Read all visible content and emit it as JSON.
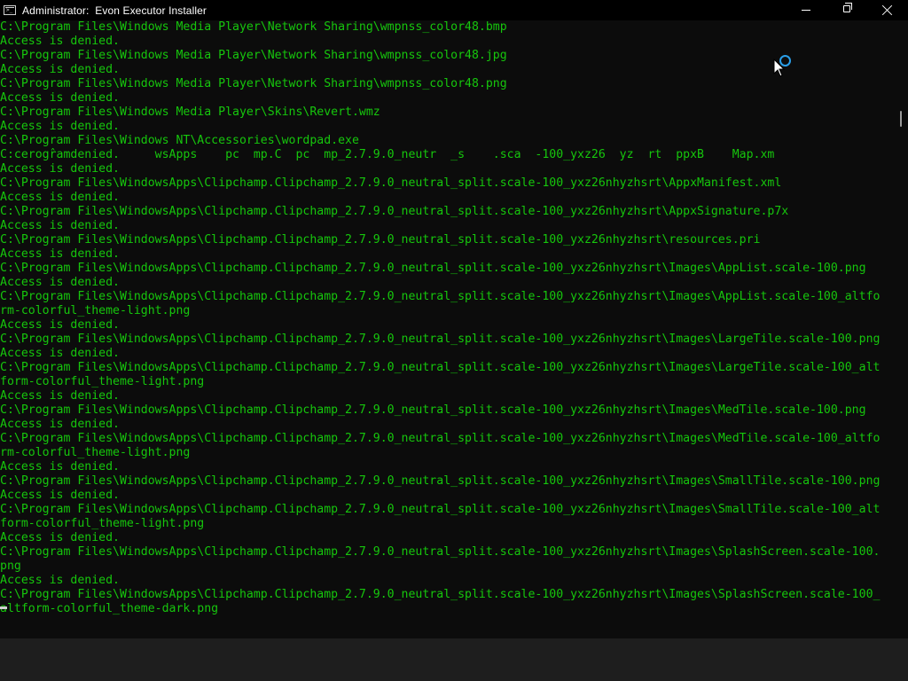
{
  "window": {
    "title": "Administrator:  Evon Executor Installer",
    "icon": "cmd-console-icon",
    "controls": {
      "minimize": "minimize-icon",
      "maximize": "maximize-icon",
      "close": "close-icon"
    }
  },
  "colors": {
    "console_background": "#0c0c0c",
    "console_text": "#16c60c",
    "titlebar_background": "#000000",
    "busy_indicator": "#2a9ee8"
  },
  "console": {
    "lines": [
      "C:\\Program Files\\Windows Media Player\\Network Sharing\\wmpnss_color48.bmp",
      "Access is denied.",
      "C:\\Program Files\\Windows Media Player\\Network Sharing\\wmpnss_color48.jpg",
      "Access is denied.",
      "C:\\Program Files\\Windows Media Player\\Network Sharing\\wmpnss_color48.png",
      "Access is denied.",
      "C:\\Program Files\\Windows Media Player\\Skins\\Revert.wmz",
      "Access is denied.",
      "C:\\Program Files\\Windows NT\\Accessories\\wordpad.exe",
      "C:cerogr̂amdenied.     wsApps    pc  mp.C  pc  mp_2.7.9.0_neutr  _s    .sca  -100_yxz26  yz  rt  ppxB    Map.xm",
      "Access is denied.",
      "C:\\Program Files\\WindowsApps\\Clipchamp.Clipchamp_2.7.9.0_neutral_split.scale-100_yxz26nhyzhsrt\\AppxManifest.xml",
      "Access is denied.",
      "C:\\Program Files\\WindowsApps\\Clipchamp.Clipchamp_2.7.9.0_neutral_split.scale-100_yxz26nhyzhsrt\\AppxSignature.p7x",
      "Access is denied.",
      "C:\\Program Files\\WindowsApps\\Clipchamp.Clipchamp_2.7.9.0_neutral_split.scale-100_yxz26nhyzhsrt\\resources.pri",
      "Access is denied.",
      "C:\\Program Files\\WindowsApps\\Clipchamp.Clipchamp_2.7.9.0_neutral_split.scale-100_yxz26nhyzhsrt\\Images\\AppList.scale-100.png",
      "Access is denied.",
      "C:\\Program Files\\WindowsApps\\Clipchamp.Clipchamp_2.7.9.0_neutral_split.scale-100_yxz26nhyzhsrt\\Images\\AppList.scale-100_altfo",
      "rm-colorful_theme-light.png",
      "Access is denied.",
      "C:\\Program Files\\WindowsApps\\Clipchamp.Clipchamp_2.7.9.0_neutral_split.scale-100_yxz26nhyzhsrt\\Images\\LargeTile.scale-100.png",
      "Access is denied.",
      "C:\\Program Files\\WindowsApps\\Clipchamp.Clipchamp_2.7.9.0_neutral_split.scale-100_yxz26nhyzhsrt\\Images\\LargeTile.scale-100_alt",
      "form-colorful_theme-light.png",
      "Access is denied.",
      "C:\\Program Files\\WindowsApps\\Clipchamp.Clipchamp_2.7.9.0_neutral_split.scale-100_yxz26nhyzhsrt\\Images\\MedTile.scale-100.png",
      "Access is denied.",
      "C:\\Program Files\\WindowsApps\\Clipchamp.Clipchamp_2.7.9.0_neutral_split.scale-100_yxz26nhyzhsrt\\Images\\MedTile.scale-100_altfo",
      "rm-colorful_theme-light.png",
      "Access is denied.",
      "C:\\Program Files\\WindowsApps\\Clipchamp.Clipchamp_2.7.9.0_neutral_split.scale-100_yxz26nhyzhsrt\\Images\\SmallTile.scale-100.png",
      "Access is denied.",
      "C:\\Program Files\\WindowsApps\\Clipchamp.Clipchamp_2.7.9.0_neutral_split.scale-100_yxz26nhyzhsrt\\Images\\SmallTile.scale-100_alt",
      "form-colorful_theme-light.png",
      "Access is denied.",
      "C:\\Program Files\\WindowsApps\\Clipchamp.Clipchamp_2.7.9.0_neutral_split.scale-100_yxz26nhyzhsrt\\Images\\SplashScreen.scale-100.",
      "png",
      "Access is denied.",
      "C:\\Program Files\\WindowsApps\\Clipchamp.Clipchamp_2.7.9.0_neutral_split.scale-100_yxz26nhyzhsrt\\Images\\SplashScreen.scale-100_",
      "altform-colorful_theme-dark.png"
    ]
  },
  "overlay": {
    "pointer": "busy-pointer-icon"
  }
}
